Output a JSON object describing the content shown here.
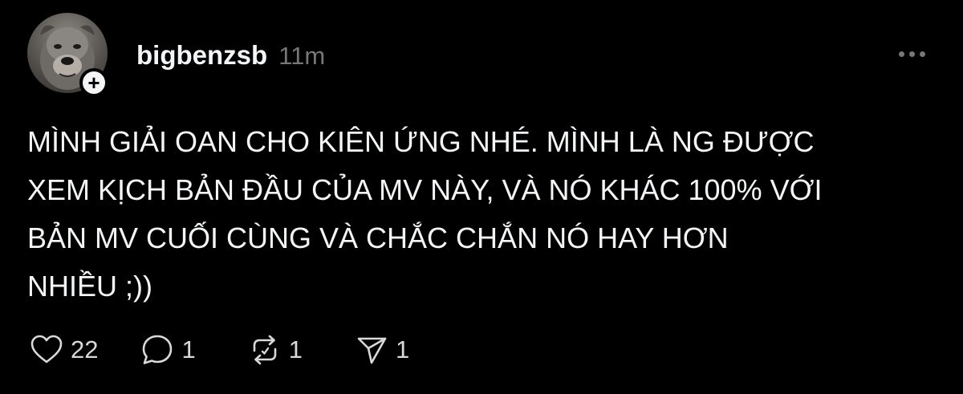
{
  "post": {
    "author": {
      "username": "bigbenzsb",
      "avatar_icon": "dog-avatar",
      "follow_icon": "+"
    },
    "timestamp": "11m",
    "more_icon": "more-horizontal-icon",
    "text": "MÌNH GIẢI OAN CHO KIÊN ỨNG NHÉ. MÌNH LÀ NG ĐƯỢC\nXEM KỊCH BẢN ĐẦU CỦA MV NÀY, VÀ NÓ KHÁC 100% VỚI\nBẢN MV CUỐI CÙNG VÀ CHẮC CHẮN NÓ HAY HƠN\nNHIỀU ;))"
  },
  "actions": {
    "like": {
      "icon": "heart-icon",
      "count": "22"
    },
    "reply": {
      "icon": "comment-icon",
      "count": "1"
    },
    "repost": {
      "icon": "repost-icon",
      "count": "1"
    },
    "share": {
      "icon": "send-icon",
      "count": "1"
    }
  },
  "colors": {
    "background": "#000000",
    "text": "#f3f5f7",
    "muted": "#777777"
  }
}
